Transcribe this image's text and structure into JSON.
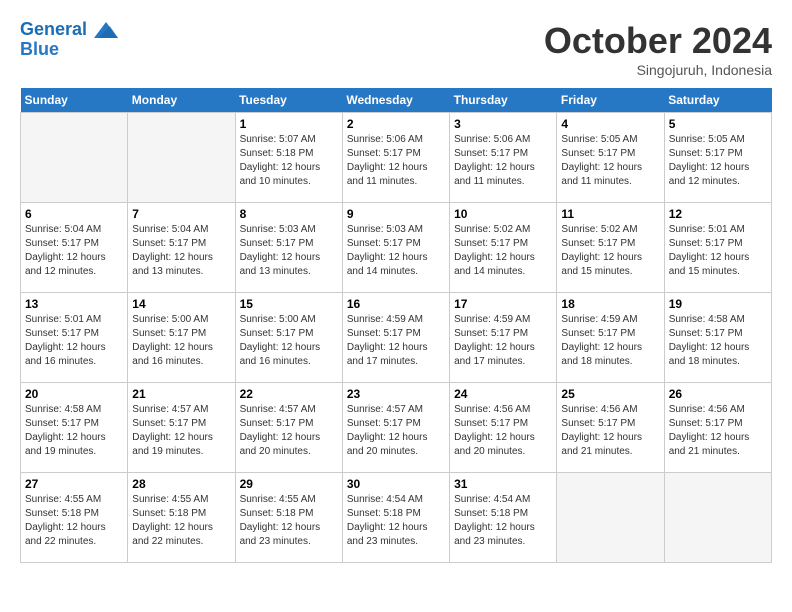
{
  "header": {
    "logo_line1": "General",
    "logo_line2": "Blue",
    "month": "October 2024",
    "location": "Singojuruh, Indonesia"
  },
  "weekdays": [
    "Sunday",
    "Monday",
    "Tuesday",
    "Wednesday",
    "Thursday",
    "Friday",
    "Saturday"
  ],
  "weeks": [
    [
      {
        "day": "",
        "empty": true
      },
      {
        "day": "",
        "empty": true
      },
      {
        "day": "1",
        "sunrise": "5:07 AM",
        "sunset": "5:18 PM",
        "daylight": "12 hours and 10 minutes."
      },
      {
        "day": "2",
        "sunrise": "5:06 AM",
        "sunset": "5:17 PM",
        "daylight": "12 hours and 11 minutes."
      },
      {
        "day": "3",
        "sunrise": "5:06 AM",
        "sunset": "5:17 PM",
        "daylight": "12 hours and 11 minutes."
      },
      {
        "day": "4",
        "sunrise": "5:05 AM",
        "sunset": "5:17 PM",
        "daylight": "12 hours and 11 minutes."
      },
      {
        "day": "5",
        "sunrise": "5:05 AM",
        "sunset": "5:17 PM",
        "daylight": "12 hours and 12 minutes."
      }
    ],
    [
      {
        "day": "6",
        "sunrise": "5:04 AM",
        "sunset": "5:17 PM",
        "daylight": "12 hours and 12 minutes."
      },
      {
        "day": "7",
        "sunrise": "5:04 AM",
        "sunset": "5:17 PM",
        "daylight": "12 hours and 13 minutes."
      },
      {
        "day": "8",
        "sunrise": "5:03 AM",
        "sunset": "5:17 PM",
        "daylight": "12 hours and 13 minutes."
      },
      {
        "day": "9",
        "sunrise": "5:03 AM",
        "sunset": "5:17 PM",
        "daylight": "12 hours and 14 minutes."
      },
      {
        "day": "10",
        "sunrise": "5:02 AM",
        "sunset": "5:17 PM",
        "daylight": "12 hours and 14 minutes."
      },
      {
        "day": "11",
        "sunrise": "5:02 AM",
        "sunset": "5:17 PM",
        "daylight": "12 hours and 15 minutes."
      },
      {
        "day": "12",
        "sunrise": "5:01 AM",
        "sunset": "5:17 PM",
        "daylight": "12 hours and 15 minutes."
      }
    ],
    [
      {
        "day": "13",
        "sunrise": "5:01 AM",
        "sunset": "5:17 PM",
        "daylight": "12 hours and 16 minutes."
      },
      {
        "day": "14",
        "sunrise": "5:00 AM",
        "sunset": "5:17 PM",
        "daylight": "12 hours and 16 minutes."
      },
      {
        "day": "15",
        "sunrise": "5:00 AM",
        "sunset": "5:17 PM",
        "daylight": "12 hours and 16 minutes."
      },
      {
        "day": "16",
        "sunrise": "4:59 AM",
        "sunset": "5:17 PM",
        "daylight": "12 hours and 17 minutes."
      },
      {
        "day": "17",
        "sunrise": "4:59 AM",
        "sunset": "5:17 PM",
        "daylight": "12 hours and 17 minutes."
      },
      {
        "day": "18",
        "sunrise": "4:59 AM",
        "sunset": "5:17 PM",
        "daylight": "12 hours and 18 minutes."
      },
      {
        "day": "19",
        "sunrise": "4:58 AM",
        "sunset": "5:17 PM",
        "daylight": "12 hours and 18 minutes."
      }
    ],
    [
      {
        "day": "20",
        "sunrise": "4:58 AM",
        "sunset": "5:17 PM",
        "daylight": "12 hours and 19 minutes."
      },
      {
        "day": "21",
        "sunrise": "4:57 AM",
        "sunset": "5:17 PM",
        "daylight": "12 hours and 19 minutes."
      },
      {
        "day": "22",
        "sunrise": "4:57 AM",
        "sunset": "5:17 PM",
        "daylight": "12 hours and 20 minutes."
      },
      {
        "day": "23",
        "sunrise": "4:57 AM",
        "sunset": "5:17 PM",
        "daylight": "12 hours and 20 minutes."
      },
      {
        "day": "24",
        "sunrise": "4:56 AM",
        "sunset": "5:17 PM",
        "daylight": "12 hours and 20 minutes."
      },
      {
        "day": "25",
        "sunrise": "4:56 AM",
        "sunset": "5:17 PM",
        "daylight": "12 hours and 21 minutes."
      },
      {
        "day": "26",
        "sunrise": "4:56 AM",
        "sunset": "5:17 PM",
        "daylight": "12 hours and 21 minutes."
      }
    ],
    [
      {
        "day": "27",
        "sunrise": "4:55 AM",
        "sunset": "5:18 PM",
        "daylight": "12 hours and 22 minutes."
      },
      {
        "day": "28",
        "sunrise": "4:55 AM",
        "sunset": "5:18 PM",
        "daylight": "12 hours and 22 minutes."
      },
      {
        "day": "29",
        "sunrise": "4:55 AM",
        "sunset": "5:18 PM",
        "daylight": "12 hours and 23 minutes."
      },
      {
        "day": "30",
        "sunrise": "4:54 AM",
        "sunset": "5:18 PM",
        "daylight": "12 hours and 23 minutes."
      },
      {
        "day": "31",
        "sunrise": "4:54 AM",
        "sunset": "5:18 PM",
        "daylight": "12 hours and 23 minutes."
      },
      {
        "day": "",
        "empty": true
      },
      {
        "day": "",
        "empty": true
      }
    ]
  ],
  "labels": {
    "sunrise": "Sunrise:",
    "sunset": "Sunset:",
    "daylight": "Daylight:"
  }
}
